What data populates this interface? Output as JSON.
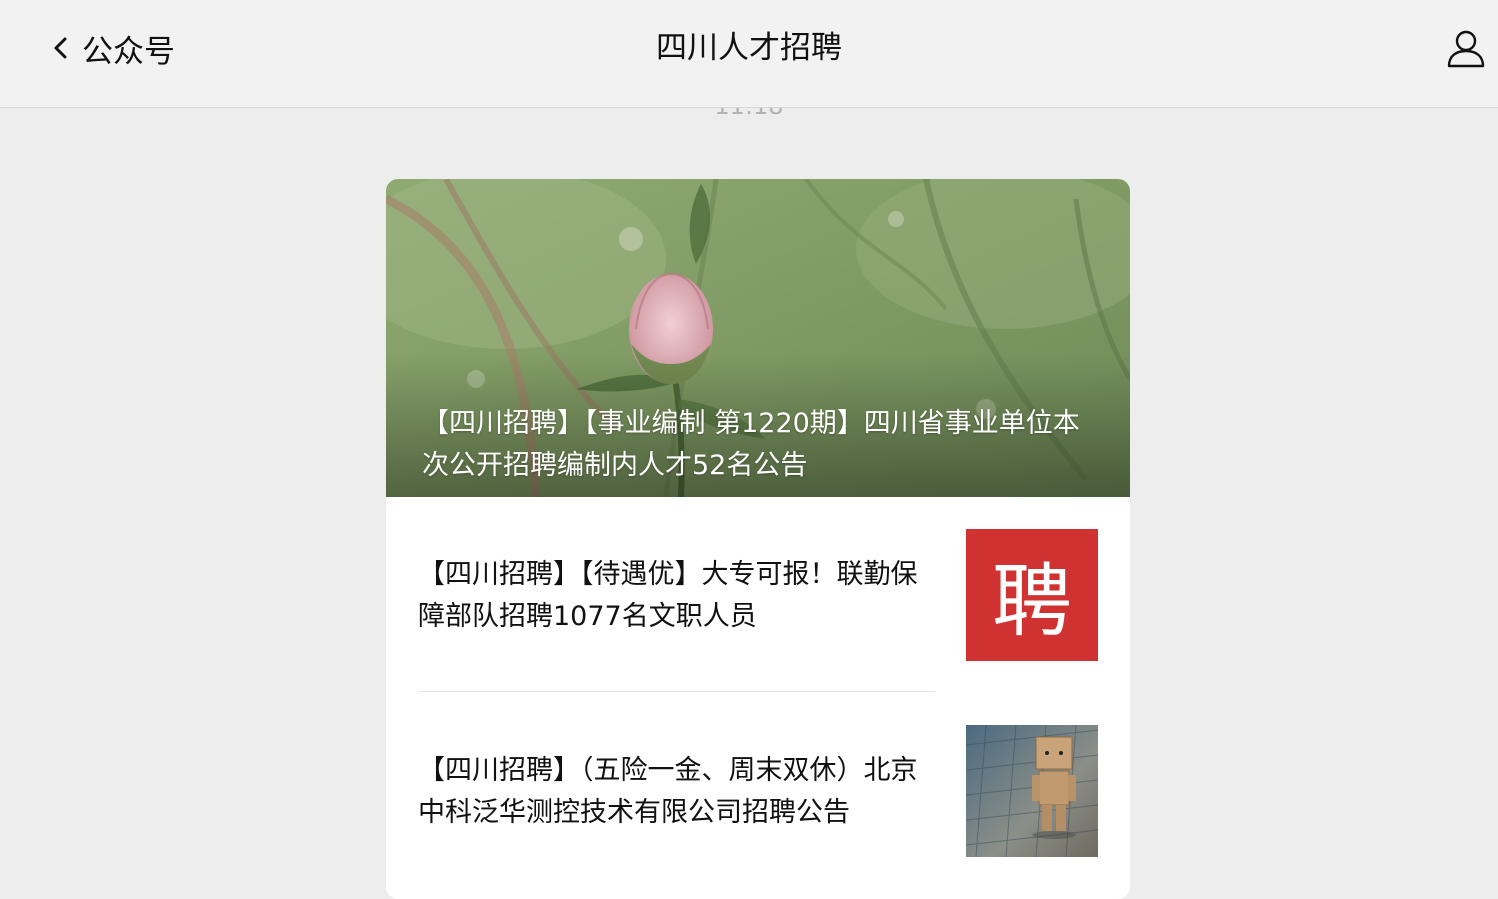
{
  "navbar": {
    "back_label": "公众号",
    "title": "四川人才招聘",
    "back_icon": "chevron-left-icon",
    "profile_icon": "person-icon"
  },
  "timestamp": "11:18",
  "articles": [
    {
      "title": "【四川招聘】【事业编制 第1220期】四川省事业单位本次公开招聘编制内人才52名公告"
    },
    {
      "title": "【四川招聘】【待遇优】大专可报！联勤保障部队招聘1077名文职人员",
      "thumb_text": "聘"
    },
    {
      "title": "【四川招聘】（五险一金、周末双休）北京中科泛华测控技术有限公司招聘公告"
    }
  ],
  "colors": {
    "background": "#ededed",
    "navbar": "#f2f2f2",
    "hire_thumb": "#cf3231"
  }
}
